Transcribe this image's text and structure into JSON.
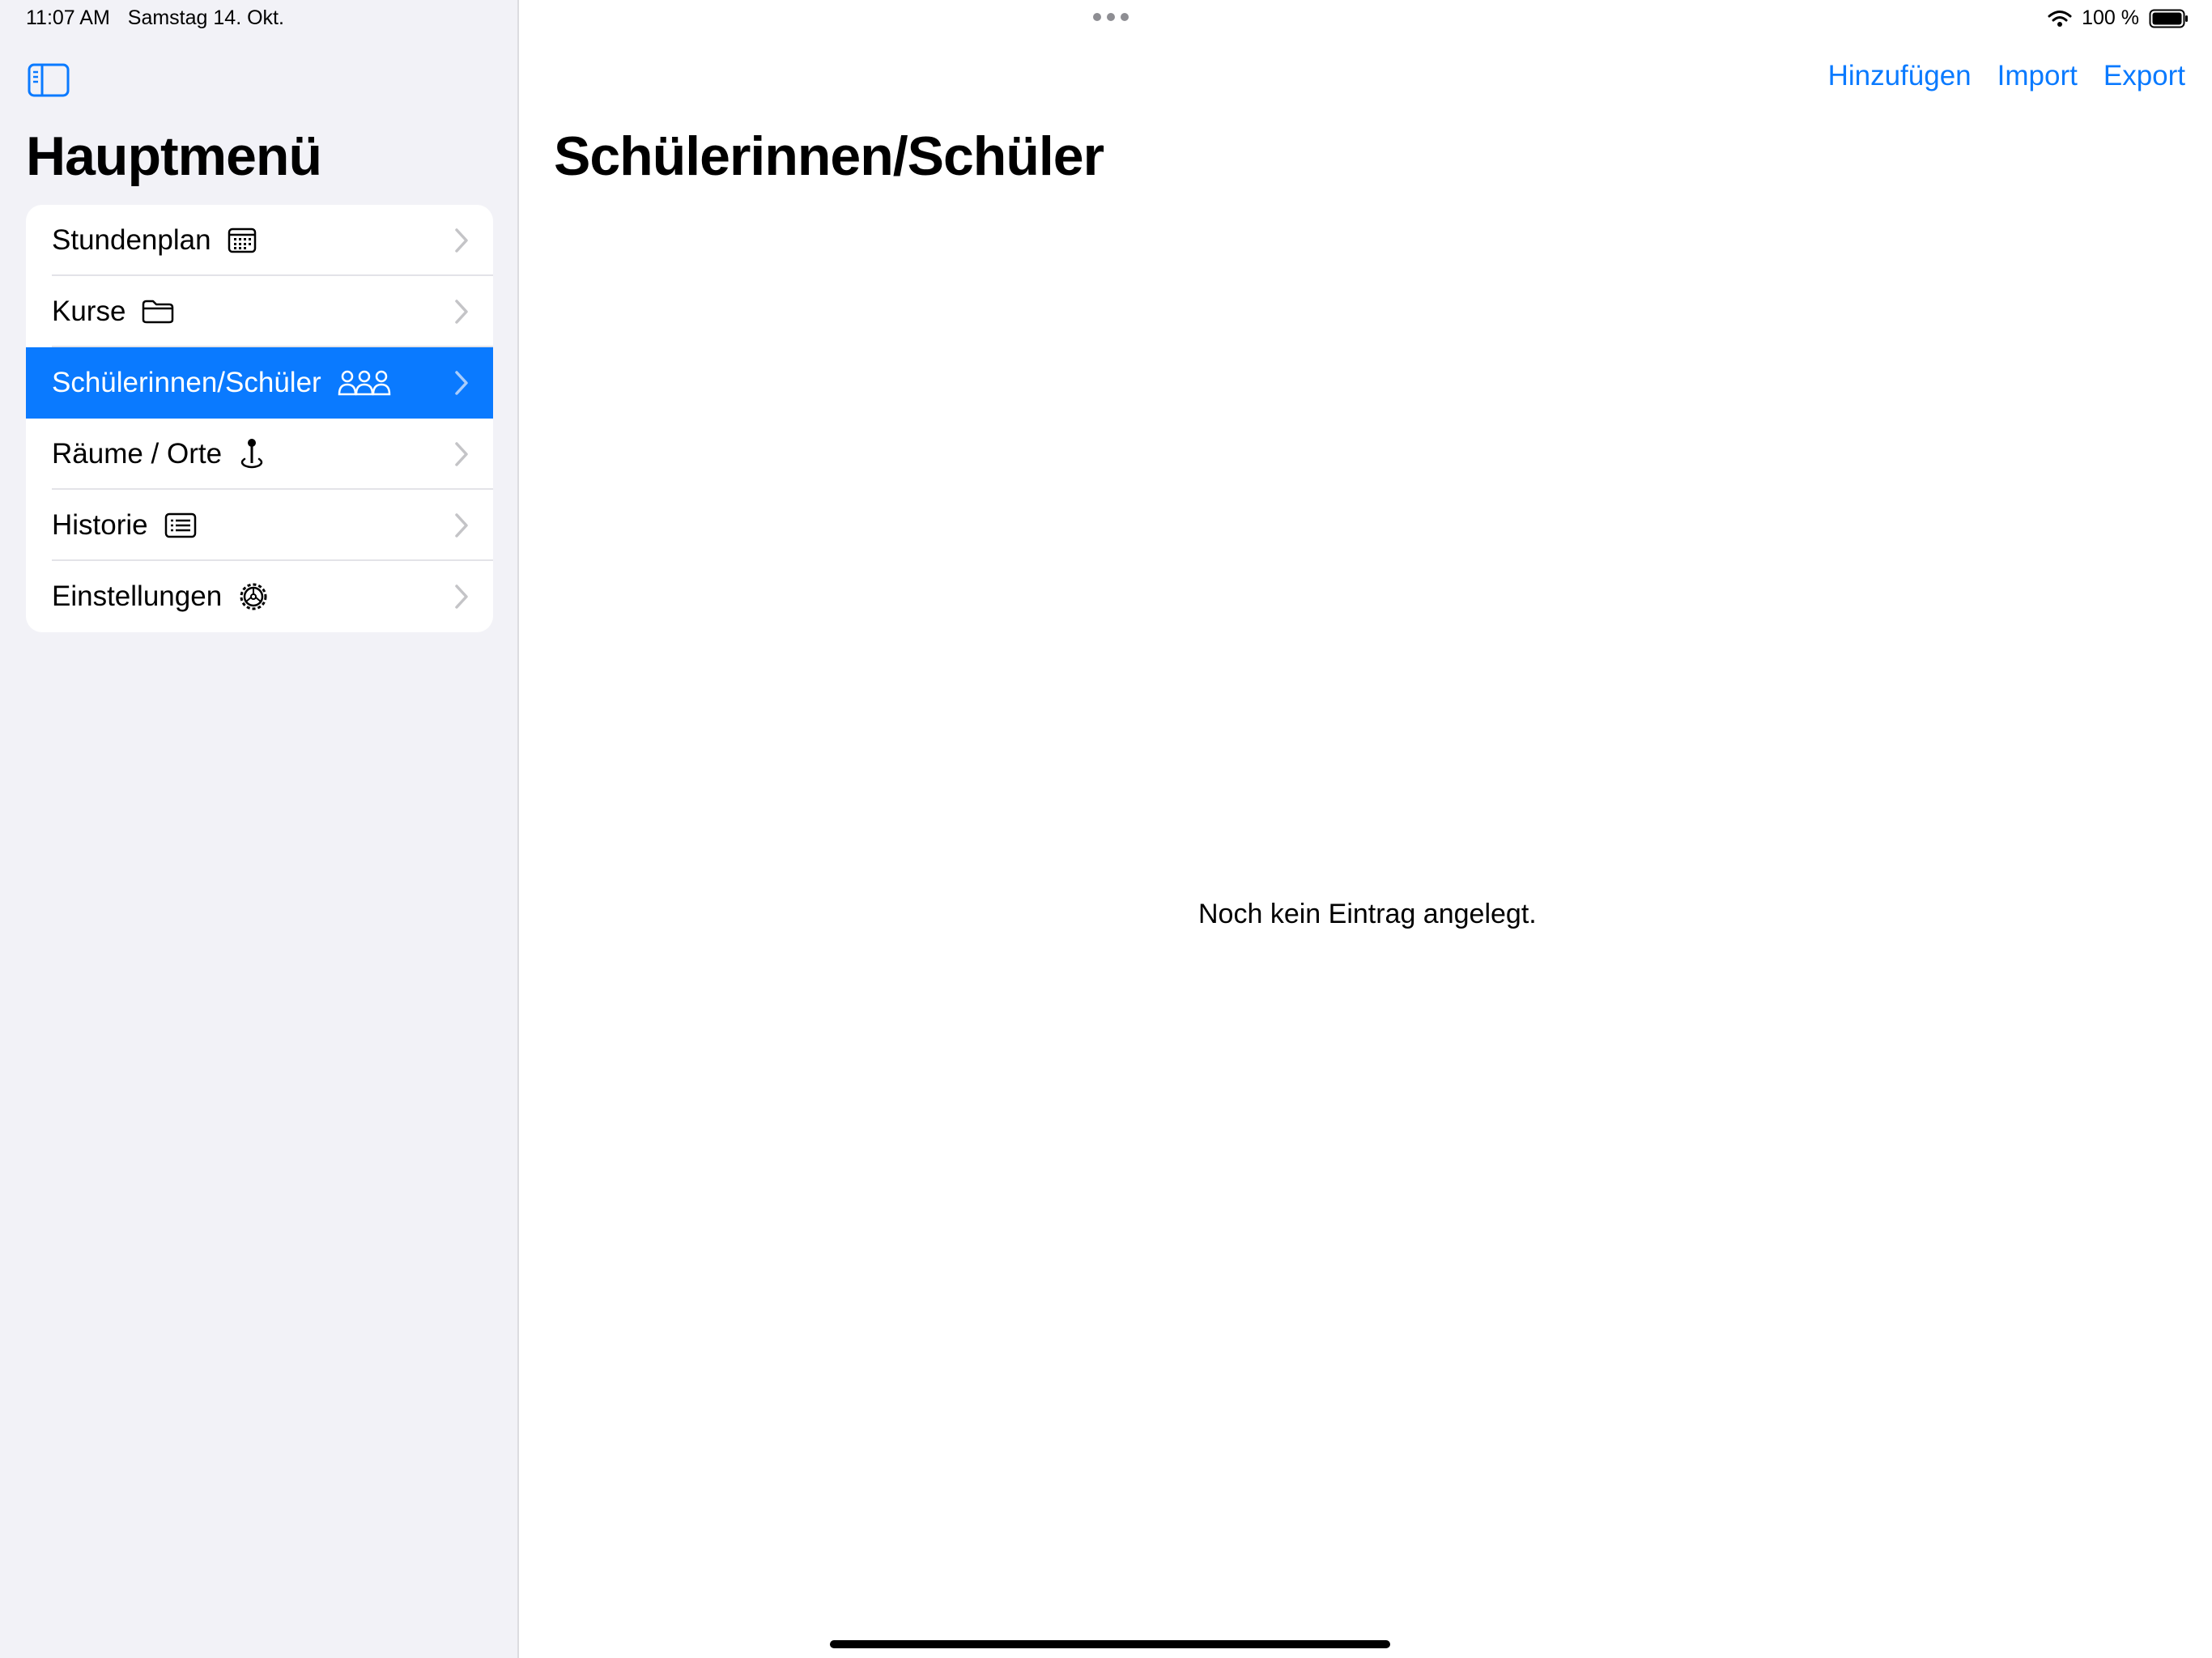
{
  "status_bar": {
    "time": "11:07 AM",
    "date": "Samstag 14. Okt.",
    "battery": "100 %"
  },
  "sidebar": {
    "title": "Hauptmenü",
    "items": [
      {
        "label": "Stundenplan",
        "icon": "calendar-icon"
      },
      {
        "label": "Kurse",
        "icon": "folder-icon"
      },
      {
        "label": "Schülerinnen/Schüler",
        "icon": "people-icon",
        "selected": true
      },
      {
        "label": "Räume / Orte",
        "icon": "location-pin-icon"
      },
      {
        "label": "Historie",
        "icon": "list-icon"
      },
      {
        "label": "Einstellungen",
        "icon": "gear-icon"
      }
    ]
  },
  "toolbar": {
    "add_label": "Hinzufügen",
    "import_label": "Import",
    "export_label": "Export"
  },
  "main": {
    "title": "Schülerinnen/Schüler",
    "empty_message": "Noch kein Eintrag angelegt."
  },
  "colors": {
    "accent": "#0a7aff",
    "sidebar_bg": "#f2f2f7"
  }
}
